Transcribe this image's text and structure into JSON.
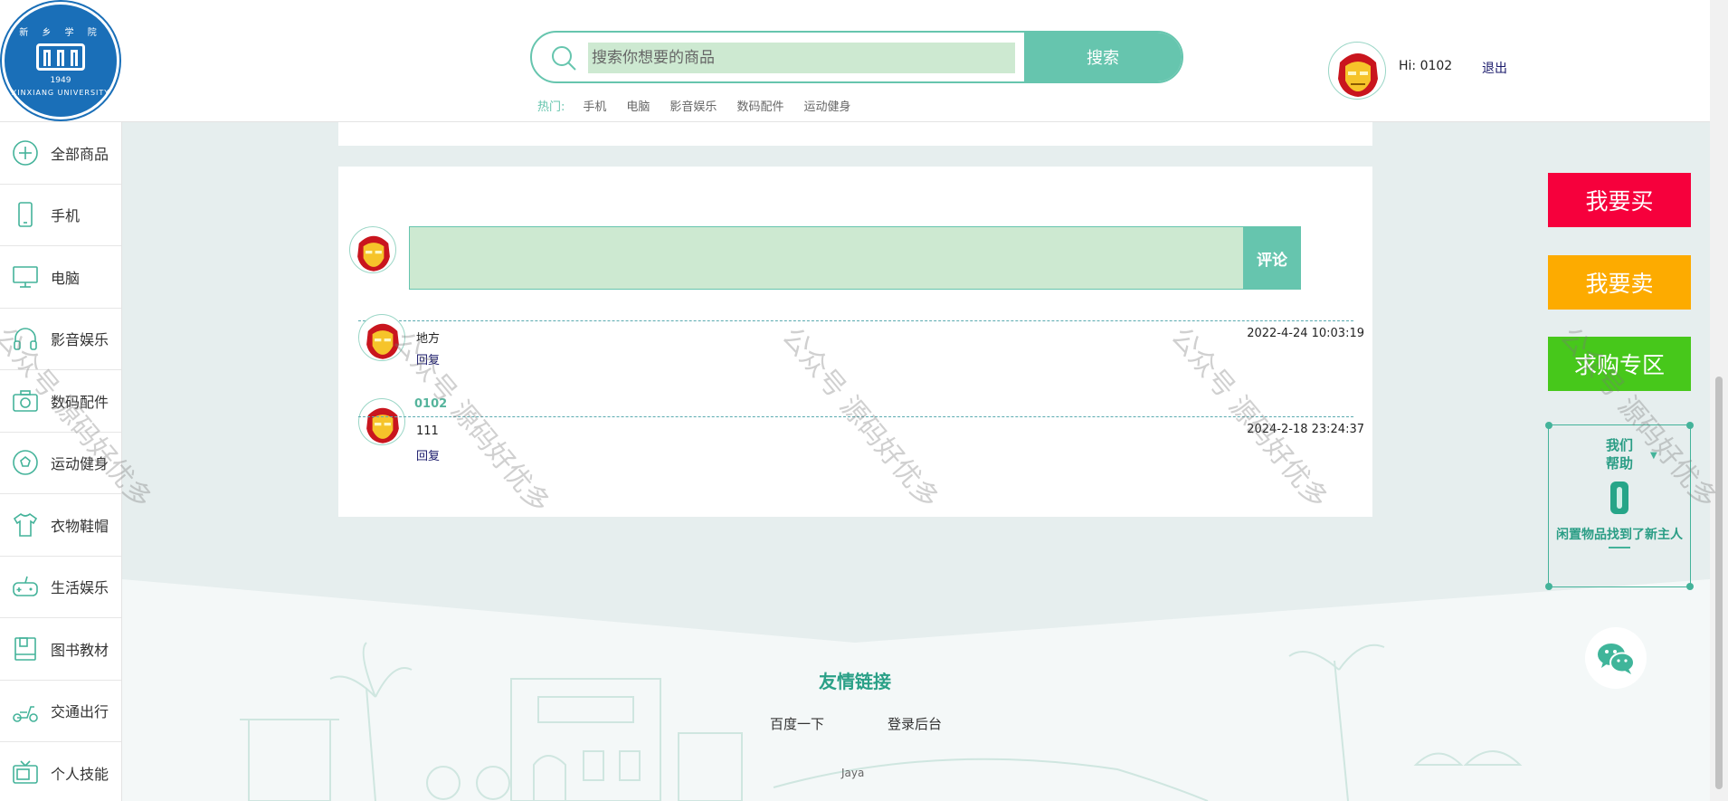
{
  "header": {
    "logo": {
      "top_text": "新 乡 学 院",
      "year": "1949",
      "bottom_text": "XINXIANG UNIVERSITY"
    },
    "search": {
      "placeholder": "搜索你想要的商品",
      "button_label": "搜索"
    },
    "hot": {
      "label": "热门:",
      "links": [
        "手机",
        "电脑",
        "影音娱乐",
        "数码配件",
        "运动健身"
      ]
    },
    "user": {
      "greeting": "Hi: 0102",
      "logout_label": "退出"
    }
  },
  "sidebar": {
    "items": [
      {
        "label": "全部商品",
        "icon": "plus-circle-icon"
      },
      {
        "label": "手机",
        "icon": "phone-icon"
      },
      {
        "label": "电脑",
        "icon": "computer-icon"
      },
      {
        "label": "影音娱乐",
        "icon": "headphones-icon"
      },
      {
        "label": "数码配件",
        "icon": "camera-icon"
      },
      {
        "label": "运动健身",
        "icon": "soccer-ball-icon"
      },
      {
        "label": "衣物鞋帽",
        "icon": "shirt-icon"
      },
      {
        "label": "生活娱乐",
        "icon": "gamepad-icon"
      },
      {
        "label": "图书教材",
        "icon": "book-icon"
      },
      {
        "label": "交通出行",
        "icon": "scooter-icon"
      },
      {
        "label": "个人技能",
        "icon": "tv-icon"
      }
    ]
  },
  "comments": {
    "textarea_value": "",
    "submit_label": "评论",
    "reply_label": "回复",
    "items": [
      {
        "author": "地方",
        "body": "",
        "time": "2022-4-24 10:03:19",
        "highlight": false
      },
      {
        "author": "0102",
        "body": "111",
        "time": "2024-2-18 23:24:37",
        "highlight": true
      }
    ]
  },
  "right_panel": {
    "buy_label": "我要买",
    "sell_label": "我要卖",
    "wanted_label": "求购专区",
    "help": {
      "title": "我们帮助",
      "text": "闲置物品找到了新主人"
    },
    "colors": {
      "buy": "#f6003c",
      "sell": "#fdab00",
      "wanted": "#47c81b",
      "accent": "#66c5ae"
    }
  },
  "footer": {
    "title": "友情链接",
    "links": [
      "百度一下",
      "登录后台"
    ],
    "credit": "Jaya"
  },
  "watermark": "公众号 源码好优多"
}
